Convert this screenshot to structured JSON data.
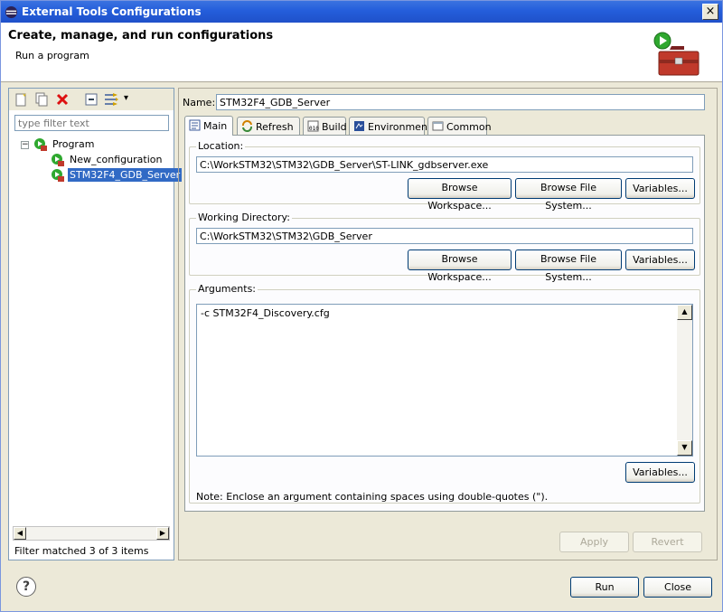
{
  "window": {
    "title": "External Tools Configurations",
    "close_glyph": "×"
  },
  "header": {
    "title": "Create, manage, and run configurations",
    "subtitle": "Run a program",
    "icon": "toolbox-run-icon"
  },
  "left_toolbar": {
    "icons": [
      "new-config-icon",
      "duplicate-icon",
      "delete-icon",
      "collapse-all-icon",
      "filter-icon",
      "dropdown-arrow-icon"
    ],
    "dropdown_glyph": "▾"
  },
  "filter": {
    "placeholder": "type filter text",
    "value": ""
  },
  "tree": {
    "root": {
      "label": "Program",
      "expander": "−"
    },
    "children": [
      {
        "label": "New_configuration",
        "selected": false
      },
      {
        "label": "STM32F4_GDB_Server",
        "selected": true
      }
    ]
  },
  "scroll": {
    "left": "◀",
    "right": "▶",
    "up": "▲",
    "down": "▼"
  },
  "filter_status": "Filter matched 3 of 3 items",
  "config": {
    "name_label": "Name:",
    "name_value": "STM32F4_GDB_Server",
    "tabs": [
      {
        "label": "Main",
        "icon": "main-tab-icon",
        "active": true
      },
      {
        "label": "Refresh",
        "icon": "refresh-icon",
        "active": false
      },
      {
        "label": "Build",
        "icon": "build-icon",
        "active": false
      },
      {
        "label": "Environment",
        "icon": "environment-icon",
        "active": false
      },
      {
        "label": "Common",
        "icon": "common-icon",
        "active": false
      }
    ],
    "location": {
      "label": "Location:",
      "value": "C:\\WorkSTM32\\STM32\\GDB_Server\\ST-LINK_gdbserver.exe",
      "browse_workspace": "Browse Workspace...",
      "browse_file_system": "Browse File System...",
      "variables": "Variables..."
    },
    "working_dir": {
      "label": "Working Directory:",
      "value": "C:\\WorkSTM32\\STM32\\GDB_Server",
      "browse_workspace": "Browse Workspace...",
      "browse_file_system": "Browse File System...",
      "variables": "Variables..."
    },
    "arguments": {
      "label": "Arguments:",
      "value": "-c STM32F4_Discovery.cfg",
      "variables": "Variables...",
      "note": "Note: Enclose an argument containing spaces using double-quotes (\")."
    },
    "apply": "Apply",
    "revert": "Revert"
  },
  "footer": {
    "help_glyph": "?",
    "run": "Run",
    "close": "Close"
  },
  "colors": {
    "selection": "#316ac5",
    "titlebar": "#245edb",
    "dialog_bg": "#ece9d8"
  }
}
